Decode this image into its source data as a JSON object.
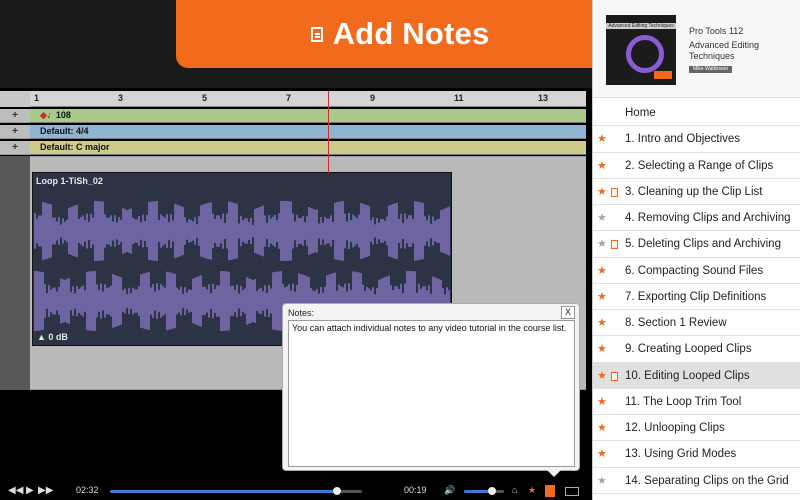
{
  "banner": {
    "title": "Add Notes"
  },
  "protools": {
    "ruler_ticks": [
      "1",
      "3",
      "5",
      "7",
      "9",
      "11",
      "13"
    ],
    "tempo": "108",
    "meter": "Default: 4/4",
    "key": "Default: C major",
    "clip_name": "Loop 1-TiSh_02",
    "clip_gain": "0 dB",
    "track_buttons": [
      "+",
      "+",
      "+"
    ]
  },
  "notes": {
    "label": "Notes:",
    "close": "X",
    "text": "You can attach individual notes to any video tutorial in the course list."
  },
  "player": {
    "elapsed": "02:32",
    "remaining": "00:19",
    "progress_fraction": 0.9,
    "volume_fraction": 0.7
  },
  "course": {
    "series": "Pro Tools 112",
    "title": "Advanced Editing Techniques",
    "author": "Mike Watkinson",
    "thumbnail_title": "Advanced Editing Techniques"
  },
  "lessons": [
    {
      "label": "Home",
      "star": "none",
      "note": false,
      "active": false
    },
    {
      "label": "1. Intro and Objectives",
      "star": "orange",
      "note": false,
      "active": false
    },
    {
      "label": "2. Selecting a Range of Clips",
      "star": "orange",
      "note": false,
      "active": false
    },
    {
      "label": "3. Cleaning up the Clip List",
      "star": "orange",
      "note": true,
      "active": false
    },
    {
      "label": "4. Removing Clips and Archiving",
      "star": "gray",
      "note": false,
      "active": false
    },
    {
      "label": "5. Deleting Clips and Archiving",
      "star": "gray",
      "note": true,
      "active": false
    },
    {
      "label": "6. Compacting Sound Files",
      "star": "orange",
      "note": false,
      "active": false
    },
    {
      "label": "7. Exporting Clip Definitions",
      "star": "orange",
      "note": false,
      "active": false
    },
    {
      "label": "8. Section 1 Review",
      "star": "orange",
      "note": false,
      "active": false
    },
    {
      "label": "9. Creating Looped Clips",
      "star": "orange",
      "note": false,
      "active": false
    },
    {
      "label": "10. Editing Looped Clips",
      "star": "orange",
      "note": true,
      "active": true
    },
    {
      "label": "11. The Loop Trim Tool",
      "star": "orange",
      "note": false,
      "active": false
    },
    {
      "label": "12. Unlooping Clips",
      "star": "orange",
      "note": false,
      "active": false
    },
    {
      "label": "13. Using Grid Modes",
      "star": "orange",
      "note": false,
      "active": false
    },
    {
      "label": "14. Separating Clips on the Grid",
      "star": "gray",
      "note": false,
      "active": false
    }
  ]
}
